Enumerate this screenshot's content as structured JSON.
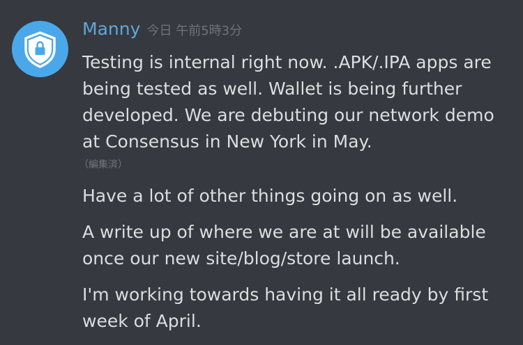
{
  "author": {
    "name": "Manny",
    "avatar_icon": "shield-lock-icon",
    "name_color": "#5fa8d8"
  },
  "timestamp": "今日 午前5時3分",
  "messages": [
    {
      "lines": [
        "Testing is internal right now. .APK/.IPA apps are",
        "being tested as well. Wallet is being further",
        "developed. We are debuting our network demo",
        "at Consensus in New York in May."
      ],
      "edited": "（編集済）"
    },
    {
      "lines": [
        "Have a lot of other things going on as well."
      ]
    },
    {
      "lines": [
        "A write up of where we are at will be available",
        "once our new site/blog/store launch."
      ]
    },
    {
      "lines": [
        "I'm working towards having it all ready by first",
        "week of April."
      ]
    }
  ],
  "colors": {
    "background": "#36393f",
    "text": "#dcddde",
    "muted": "#72767d",
    "avatar_bg": "#4aa8ea"
  }
}
